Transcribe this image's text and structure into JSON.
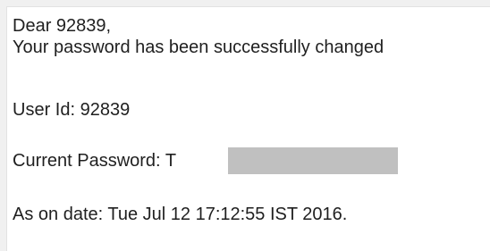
{
  "email": {
    "greeting": "Dear 92839,",
    "message": "Your password has been successfully changed",
    "user_id_line": "User Id: 92839",
    "current_password_label": "Current Password:",
    "password_visible_prefix": "T",
    "date_line": "As on date: Tue Jul 12 17:12:55 IST 2016."
  },
  "colors": {
    "page_background": "#f0f0f0",
    "panel_background": "#ffffff",
    "text": "#1f1f1f",
    "redaction": "#c0c0c0"
  }
}
